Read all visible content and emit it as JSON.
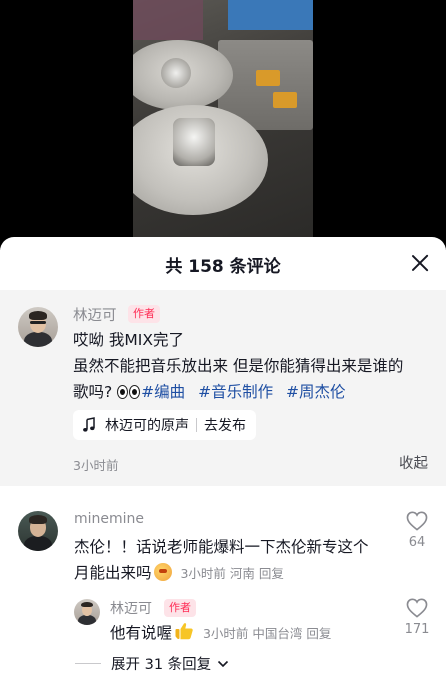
{
  "sheet": {
    "title": "共 158 条评论"
  },
  "pinned_comment": {
    "author": "林迈可",
    "badge": "作者",
    "line1": "哎呦 我MIX完了",
    "line2": "虽然不能把音乐放出来 但是你能猜得出来是谁的",
    "line3_prefix": "歌吗?",
    "hashtags": [
      "#编曲",
      "#音乐制作",
      "#周杰伦"
    ],
    "music_chip": {
      "label": "林迈可的原声",
      "action": "去发布"
    },
    "time": "3小时前",
    "collapse_label": "收起"
  },
  "comments": [
    {
      "username": "minemine",
      "text_line1": "杰伦！！话说老师能爆料一下杰伦新专这个",
      "text_line2": "月能出来吗",
      "meta": "3小时前 河南",
      "reply_label": "回复",
      "likes": "64"
    }
  ],
  "reply": {
    "author": "林迈可",
    "badge": "作者",
    "text": "他有说喔",
    "meta": "3小时前 中国台湾",
    "reply_label": "回复",
    "likes": "171",
    "expand_label": "展开 31 条回复"
  },
  "colors": {
    "accent_badge": "#fe2c55",
    "hashtag": "#1f4fa3",
    "muted_text": "#8a8b91"
  },
  "icons": [
    "close-icon",
    "music-note-icon",
    "heart-outline-icon",
    "chevron-down-icon",
    "eyes-emoji",
    "cat-emoji",
    "thumbs-up-emoji"
  ]
}
